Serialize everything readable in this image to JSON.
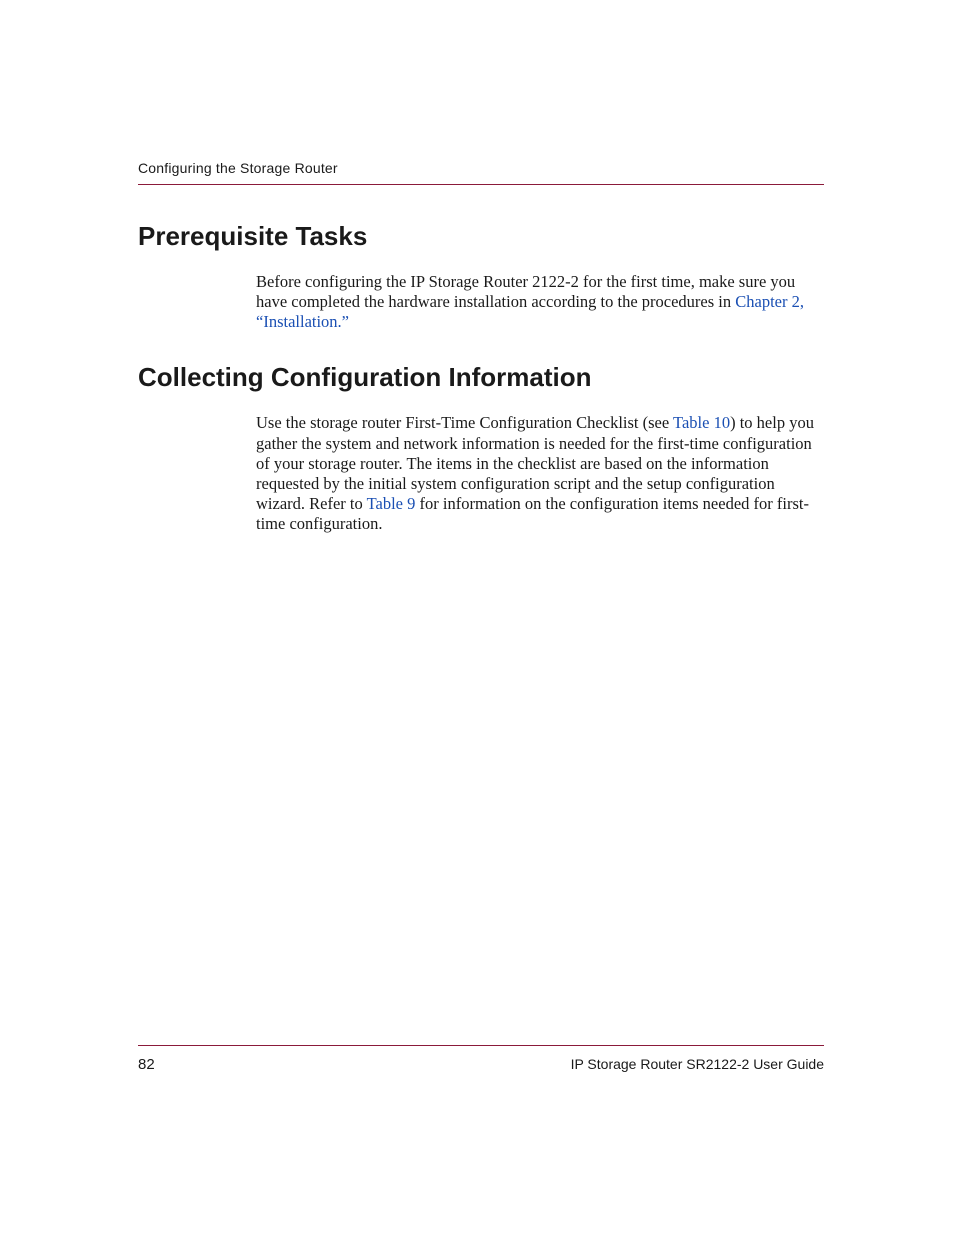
{
  "header": {
    "section_title": "Configuring the Storage Router"
  },
  "sections": {
    "prereq": {
      "heading": "Prerequisite Tasks",
      "para1_part1": "Before configuring the IP Storage Router 2122-2 for the first time, make sure you have completed the hardware installation according to the procedures in ",
      "para1_link": "Chapter 2, “Installation.”"
    },
    "collecting": {
      "heading": "Collecting Configuration Information",
      "para1_part1": "Use the storage router First-Time Configuration Checklist (see ",
      "para1_link1": "Table 10",
      "para1_part2": ") to help you gather the system and network information is needed for the first-time configuration of your storage router. The items in the checklist are based on the information requested by the initial system configuration script and the setup configuration wizard. Refer to ",
      "para1_link2": "Table 9",
      "para1_part3": " for information on the configuration items needed for first-time configuration."
    }
  },
  "footer": {
    "page_number": "82",
    "doc_title": "IP Storage Router SR2122-2 User Guide"
  }
}
